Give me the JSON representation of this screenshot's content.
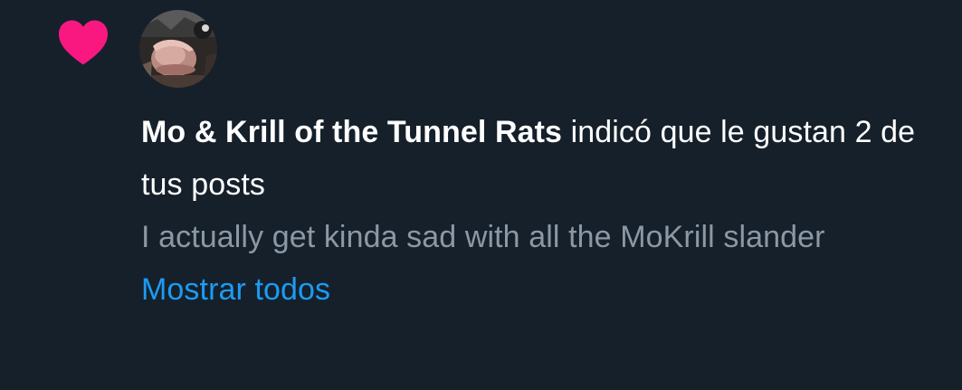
{
  "colors": {
    "background": "#15202b",
    "heart": "#f91880",
    "primary_text": "#ffffff",
    "secondary_text": "#8b98a5",
    "link": "#1d9bf0"
  },
  "notification": {
    "type_icon": "heart-icon",
    "avatar_icon": "user-avatar",
    "actor_name": "Mo & Krill of the Tunnel Rats",
    "action_text": " indicó que le gustan 2 de tus posts",
    "post_preview": "I actually get kinda sad with all the MoKrill slander",
    "show_all_label": "Mostrar todos"
  }
}
